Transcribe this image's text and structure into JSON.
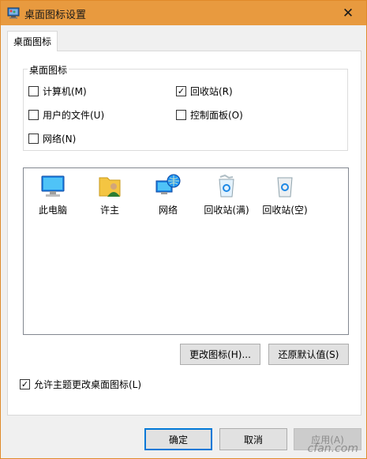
{
  "window": {
    "title": "桌面图标设置",
    "close_glyph": "✕",
    "title_bar_color": "#e89a3f"
  },
  "tabs": [
    {
      "label": "桌面图标"
    }
  ],
  "desktop_icons_group": {
    "legend": "桌面图标",
    "options": [
      {
        "label": "计算机(M)",
        "checked": false
      },
      {
        "label": "回收站(R)",
        "checked": true
      },
      {
        "label": "用户的文件(U)",
        "checked": false
      },
      {
        "label": "控制面板(O)",
        "checked": false
      },
      {
        "label": "网络(N)",
        "checked": false
      }
    ]
  },
  "icon_list": [
    {
      "label": "此电脑",
      "icon": "computer-icon"
    },
    {
      "label": "许主",
      "icon": "user-folder-icon"
    },
    {
      "label": "网络",
      "icon": "network-icon"
    },
    {
      "label": "回收站(满)",
      "icon": "recycle-bin-full-icon"
    },
    {
      "label": "回收站(空)",
      "icon": "recycle-bin-empty-icon"
    }
  ],
  "icon_buttons": {
    "change_icon": "更改图标(H)...",
    "restore_default": "还原默认值(S)"
  },
  "allow_themes": {
    "label": "允许主题更改桌面图标(L)",
    "checked": true
  },
  "footer": {
    "ok": "确定",
    "cancel": "取消",
    "apply": "应用(A)"
  },
  "check_glyph": "✓",
  "watermark": "cfan.com"
}
